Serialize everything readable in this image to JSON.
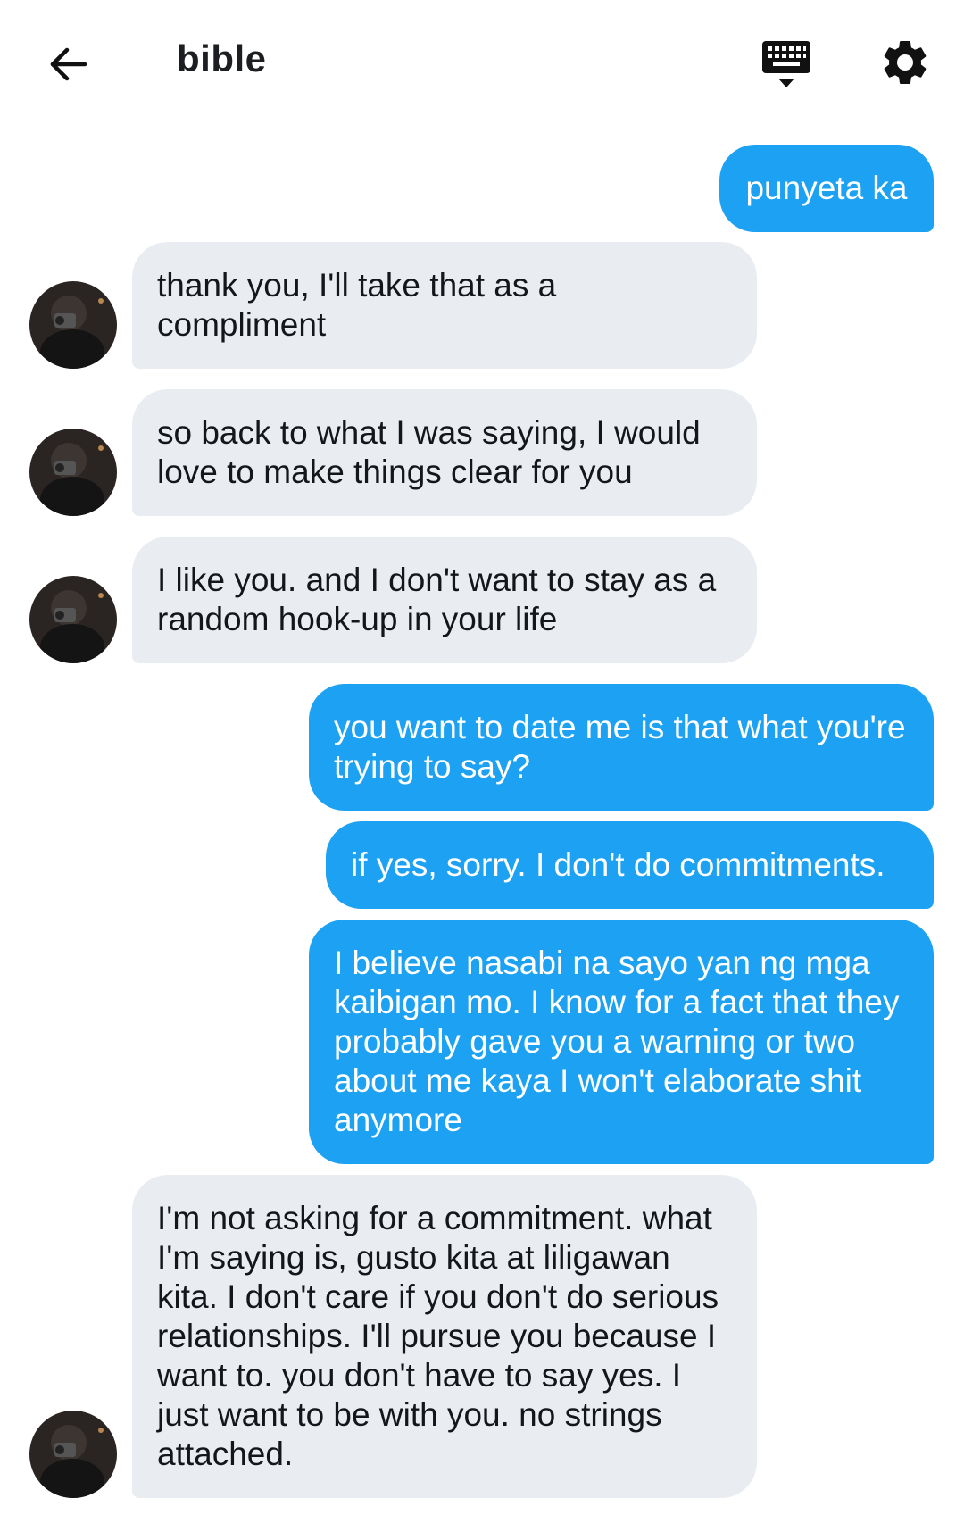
{
  "header": {
    "title": "bible",
    "icons": {
      "back": "arrow-left-icon",
      "keyboard": "keyboard-icon",
      "settings": "gear-icon"
    }
  },
  "colors": {
    "outgoing_bubble": "#1da1f2",
    "incoming_bubble": "#e9edf1",
    "text": "#1c1e21"
  },
  "messages": [
    {
      "direction": "out",
      "text": "punyeta ka"
    },
    {
      "direction": "in",
      "text": "thank you, I'll take that as a compliment"
    },
    {
      "direction": "in",
      "text": "so back to what I was saying, I would love to make things clear for you"
    },
    {
      "direction": "in",
      "text": "I like you. and I don't want to stay as a random hook-up in your life"
    },
    {
      "direction": "out",
      "text": "you want to date me is that what you're trying to say?"
    },
    {
      "direction": "out",
      "text": "if yes, sorry. I don't do commitments."
    },
    {
      "direction": "out",
      "text": "I believe nasabi na sayo yan ng mga kaibigan mo. I know for a fact that they probably gave you a warning or two about me kaya I won't elaborate shit anymore"
    },
    {
      "direction": "in",
      "text": "I'm not asking for a commitment. what I'm saying is, gusto kita at liligawan kita. I don't care if you don't do serious relationships. I'll pursue you because I want to. you don't have to say yes. I just want to be with you. no strings attached."
    }
  ]
}
